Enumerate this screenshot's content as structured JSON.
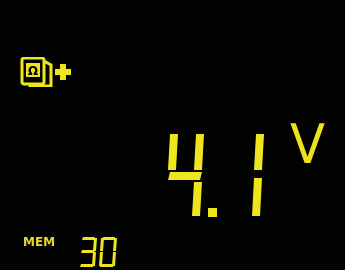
{
  "display": {
    "mode_icons": [
      "ohm-book-icon",
      "plus-icon"
    ],
    "main_reading": {
      "value": "4.1",
      "unit": "V"
    },
    "memory": {
      "label": "MEM",
      "number": "30"
    },
    "colors": {
      "background": "#000000",
      "segment": "#efe51f"
    }
  }
}
